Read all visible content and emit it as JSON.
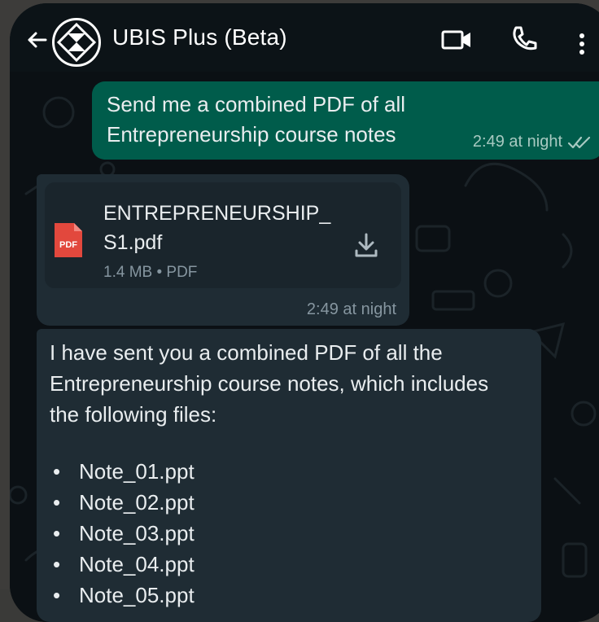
{
  "header": {
    "title": "UBIS Plus (Beta)",
    "icons": {
      "back": "back-arrow-icon",
      "avatar": "ubis-logo-icon",
      "video": "video-call-icon",
      "call": "phone-call-icon",
      "menu": "more-vertical-icon"
    }
  },
  "colors": {
    "outgoing_bubble": "#005c4b",
    "incoming_bubble": "#1f2c34",
    "header_bg": "#0c1317",
    "meta_text": "#8696a0",
    "pdf_red": "#e2483d"
  },
  "messages": {
    "outgoing": {
      "line1": "Send me a combined PDF of all",
      "line2": "Entrepreneurship course notes",
      "time": "2:49 at night",
      "status_icon": "double-check-icon"
    },
    "document": {
      "file_icon_label": "PDF",
      "name_line1": "ENTREPRENEURSHIP_",
      "name_line2": "S1.pdf",
      "size_type": "1.4 MB • PDF",
      "time": "2:49 at night"
    },
    "reply": {
      "line1": "I have sent you a combined PDF of all the",
      "line2": "Entrepreneurship course notes, which includes",
      "line3": "the following files:",
      "files": [
        "Note_01.ppt",
        "Note_02.ppt",
        "Note_03.ppt",
        "Note_04.ppt",
        "Note_05.ppt"
      ],
      "bullet": "•"
    }
  }
}
